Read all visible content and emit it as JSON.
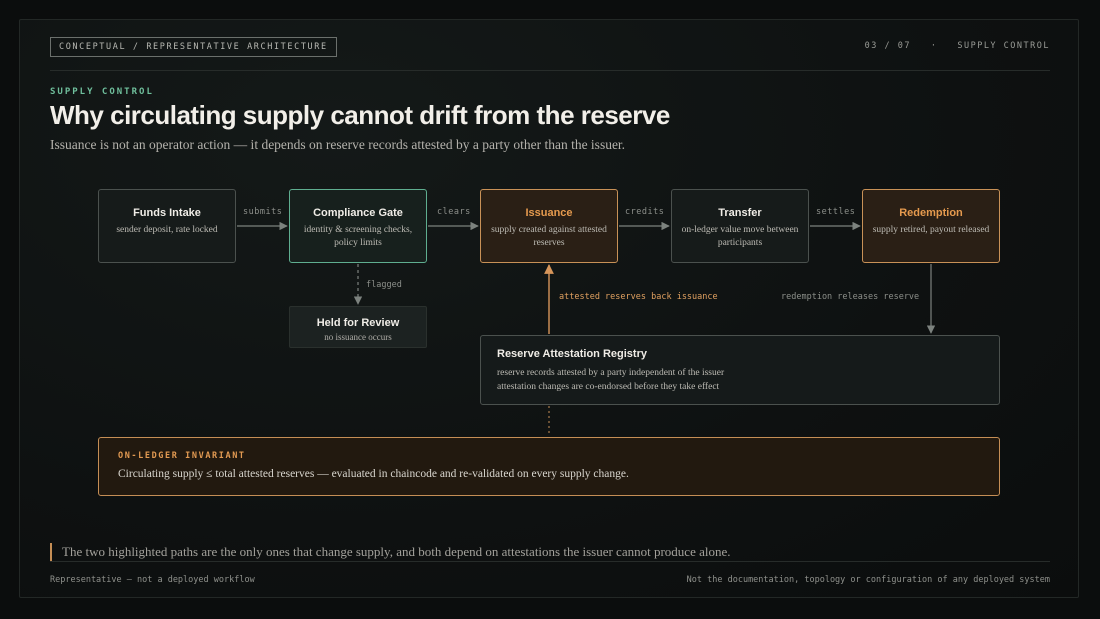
{
  "header": {
    "tag": "CONCEPTUAL / REPRESENTATIVE ARCHITECTURE",
    "slide_number": "03 / 07",
    "separator": "·",
    "section": "SUPPLY CONTROL"
  },
  "eyebrow": "SUPPLY CONTROL",
  "title": "Why circulating supply cannot drift from the reserve",
  "subtitle": "Issuance is not an operator action — it depends on reserve records attested by a party other than the issuer.",
  "flow": {
    "nodes": [
      {
        "title": "Funds Intake",
        "desc": "sender deposit, rate locked",
        "style": "neutral"
      },
      {
        "title": "Compliance Gate",
        "desc": "identity & screening checks, policy limits",
        "style": "green"
      },
      {
        "title": "Issuance",
        "desc": "supply created against attested reserves",
        "style": "amber"
      },
      {
        "title": "Transfer",
        "desc": "on-ledger value move between participants",
        "style": "neutral"
      },
      {
        "title": "Redemption",
        "desc": "supply retired, payout released",
        "style": "amber"
      }
    ],
    "edges": [
      "submits",
      "clears",
      "credits",
      "settles"
    ],
    "flagged_label": "flagged",
    "review": {
      "title": "Held for Review",
      "desc": "no issuance occurs"
    },
    "attested_label": "attested reserves back issuance",
    "redemption_label": "redemption releases reserve"
  },
  "registry": {
    "title": "Reserve Attestation Registry",
    "line1": "reserve records attested by a party independent of the issuer",
    "line2": "attestation changes are co-endorsed before they take effect"
  },
  "invariant": {
    "label": "ON-LEDGER INVARIANT",
    "text": "Circulating supply ≤ total attested reserves — evaluated in chaincode and re-validated on every supply change."
  },
  "note": "The two highlighted paths are the only ones that change supply, and both depend on attestations the issuer cannot produce alone.",
  "footer": {
    "left": "Representative — not a deployed workflow",
    "right": "Not the documentation, topology or configuration of any deployed system"
  },
  "colors": {
    "accent_green": "#6fbf9c",
    "accent_amber": "#e29a52",
    "wire": "#7c827e"
  }
}
